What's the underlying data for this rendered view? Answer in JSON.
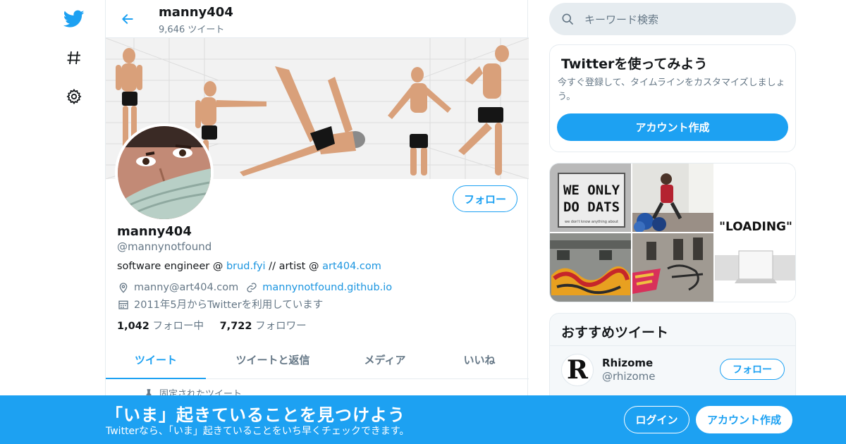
{
  "nav": {
    "logo_icon": "twitter-bird-icon",
    "explore_icon": "hashtag-icon",
    "settings_icon": "gear-icon"
  },
  "header": {
    "name": "manny404",
    "tweet_count": "9,646 ツイート"
  },
  "profile": {
    "follow_label": "フォロー",
    "name": "manny404",
    "handle": "@mannynotfound",
    "bio_prefix": "software engineer @ ",
    "bio_link1": "brud.fyi",
    "bio_middle": " // artist @ ",
    "bio_link2": "art404.com",
    "location": "manny@art404.com",
    "website": "mannynotfound.github.io",
    "joined": "2011年5月からTwitterを利用しています",
    "following_count": "1,042",
    "following_label": " フォロー中",
    "followers_count": "7,722",
    "followers_label": " フォロワー"
  },
  "tabs": [
    "ツイート",
    "ツイートと返信",
    "メディア",
    "いいね"
  ],
  "pinned_label": "固定されたツイート",
  "search": {
    "placeholder": "キーワード検索"
  },
  "signup_card": {
    "title": "Twitterを使ってみよう",
    "text": "今すぐ登録して、タイムラインをカスタマイズしましょう。",
    "button": "アカウント作成"
  },
  "media": {
    "tile1_text_line1": "WE ONLY",
    "tile1_text_line2": "DO DATS",
    "tile1_small": "we don't know anything about",
    "tile3_text": "\"LOADING\""
  },
  "recommended": {
    "title": "おすすめツイート",
    "account_name": "Rhizome",
    "account_handle": "@rhizome",
    "avatar_letter": "R",
    "follow_label": "フォロー"
  },
  "bottom_bar": {
    "title": "「いま」起きていることを見つけよう",
    "subtitle": "Twitterなら、「いま」起きていることをいち早くチェックできます。",
    "login": "ログイン",
    "signup": "アカウント作成"
  },
  "colors": {
    "accent": "#1da1f2",
    "link": "#1b95e0",
    "muted": "#657786",
    "border": "#e6ecf0"
  }
}
